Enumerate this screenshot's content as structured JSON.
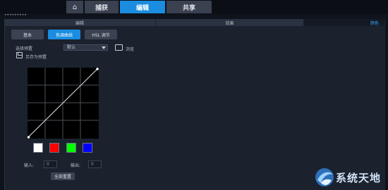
{
  "nav": {
    "home_icon": "home-icon",
    "tabs": [
      {
        "label": "捕获",
        "active": false
      },
      {
        "label": "编辑",
        "active": true
      },
      {
        "label": "共享",
        "active": false
      }
    ]
  },
  "handle": "•••••••••",
  "subtabs": [
    {
      "label": "编辑",
      "active": false
    },
    {
      "label": "效果",
      "active": false
    },
    {
      "label": "颜色",
      "active": true
    }
  ],
  "modes": [
    {
      "label": "基本",
      "active": false
    },
    {
      "label": "色调曲线",
      "active": true
    },
    {
      "label": "HSL 调节",
      "active": false
    }
  ],
  "preset": {
    "label": "选择预置",
    "value": "默认",
    "browse_label": "浏览",
    "save_label": "另存为预置"
  },
  "channels": [
    {
      "name": "white",
      "color": "#ffffff"
    },
    {
      "name": "red",
      "color": "#ff0000"
    },
    {
      "name": "green",
      "color": "#00ff00"
    },
    {
      "name": "blue",
      "color": "#0000ff"
    }
  ],
  "io": {
    "input_label": "输入:",
    "input_value": "0",
    "output_label": "输出:",
    "output_value": "0"
  },
  "reset_label": "全部重置",
  "watermark": {
    "text": "系统天地"
  },
  "colors": {
    "accent": "#1a8de0",
    "active_tab_text": "#39a7ff"
  }
}
